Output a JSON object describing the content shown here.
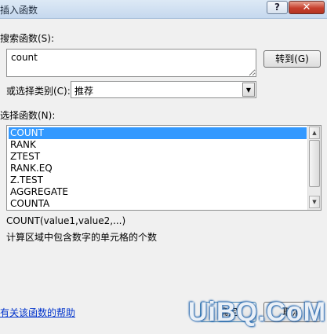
{
  "window": {
    "title": "插入函数",
    "help_button": "?",
    "close_button": "✕"
  },
  "search": {
    "label": "搜索函数(S):",
    "value": "count",
    "goto_label": "转到(G)"
  },
  "category": {
    "label": "或选择类别(C):",
    "selected": "推荐"
  },
  "functions": {
    "label": "选择函数(N):",
    "items": [
      "COUNT",
      "RANK",
      "ZTEST",
      "RANK.EQ",
      "Z.TEST",
      "AGGREGATE",
      "COUNTA"
    ],
    "selected_index": 0
  },
  "description": {
    "syntax": "COUNT(value1,value2,...)",
    "text": "计算区域中包含数字的单元格的个数"
  },
  "footer": {
    "help_link": "有关该函数的帮助",
    "ok_label": "确定",
    "cancel_label": "取消"
  },
  "watermark": "UiBQ.CoM"
}
